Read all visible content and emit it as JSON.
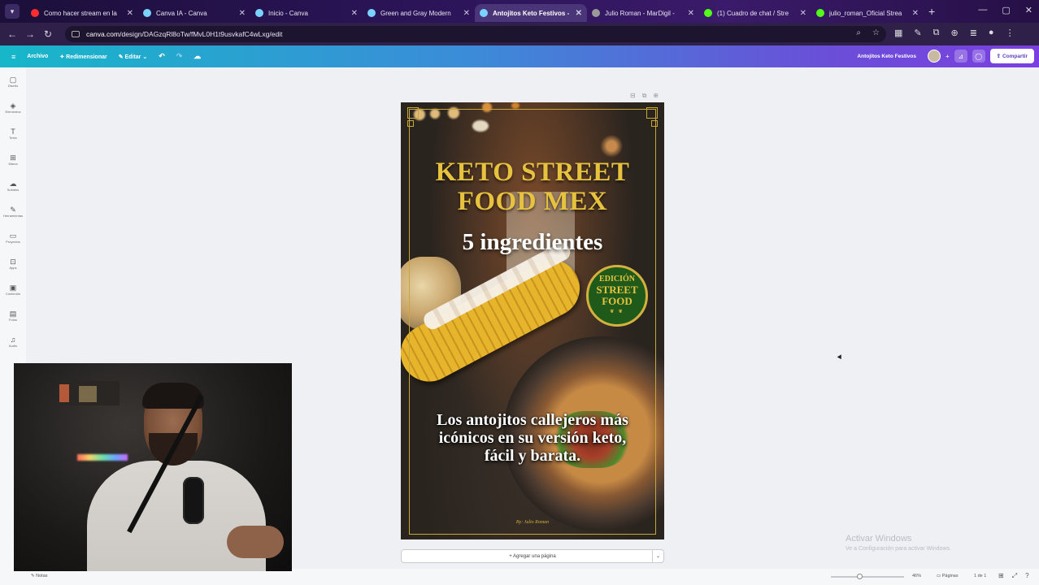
{
  "browser": {
    "tabs": [
      {
        "title": "Como hacer stream en la",
        "color": "#ff2d2d"
      },
      {
        "title": "Canva IA - Canva",
        "color": "#7ad3ff"
      },
      {
        "title": "Inicio - Canva",
        "color": "#7ad3ff"
      },
      {
        "title": "Green and Gray Modern",
        "color": "#7ad3ff"
      },
      {
        "title": "Antojitos Keto Festivos -",
        "color": "#7ad3ff"
      },
      {
        "title": "Julio Roman - MarDigil -",
        "color": "#9a9a9a"
      },
      {
        "title": "(1) Cuadro de chat / Stre",
        "color": "#53fc18"
      },
      {
        "title": "julio_roman_Oficial Strea",
        "color": "#53fc18"
      }
    ],
    "active_tab_index": 4,
    "url_host": "canva.com",
    "url_path": "/design/DAGzqRl8oTw/fMvL0H1t9usvkafC4wLxg/edit"
  },
  "canva_header": {
    "archivo": "Archivo",
    "redimensionar": "Redimensionar",
    "editar": "Editar",
    "doc_name": "Antojitos Keto Festivos",
    "share": "Compartir"
  },
  "sidebar": [
    {
      "icon": "▢",
      "label": "Diseño",
      "icon_name": "design-icon"
    },
    {
      "icon": "◈",
      "label": "Elementos",
      "icon_name": "elements-icon"
    },
    {
      "icon": "T",
      "label": "Texto",
      "icon_name": "text-icon"
    },
    {
      "icon": "⊞",
      "label": "Marca",
      "icon_name": "brand-icon"
    },
    {
      "icon": "☁",
      "label": "Subidos",
      "icon_name": "upload-icon"
    },
    {
      "icon": "✎",
      "label": "Herramientas",
      "icon_name": "draw-icon"
    },
    {
      "icon": "▭",
      "label": "Proyectos",
      "icon_name": "projects-icon"
    },
    {
      "icon": "⊡",
      "label": "Apps",
      "icon_name": "apps-icon"
    },
    {
      "icon": "▣",
      "label": "Contenido",
      "icon_name": "content-icon"
    },
    {
      "icon": "▤",
      "label": "Fotos",
      "icon_name": "photos-icon"
    },
    {
      "icon": "♫",
      "label": "Audio",
      "icon_name": "audio-icon"
    }
  ],
  "design": {
    "title_line1": "KETO STREET",
    "title_line2": "FOOD MEX",
    "subtitle": "5 ingredientes",
    "badge_line1": "EDICIÓN",
    "badge_line2": "STREET",
    "badge_line3": "FOOD",
    "tagline_line1": "Los antojitos callejeros más",
    "tagline_line2": "icónicos en su versión keto,",
    "tagline_line3": "fácil y barata.",
    "author": "By: Julio Roman",
    "gold": "#e6c23e",
    "badge_green": "#1f5a1a"
  },
  "add_page": "+ Agregar una página",
  "watermark": {
    "line1": "Activar Windows",
    "line2": "Ve a Configuración para activar Windows."
  },
  "footer": {
    "notes": "Notas",
    "zoom": "46%",
    "zoom_fraction": 0.35,
    "pages": "Páginas",
    "page_count": "1 de 1"
  }
}
